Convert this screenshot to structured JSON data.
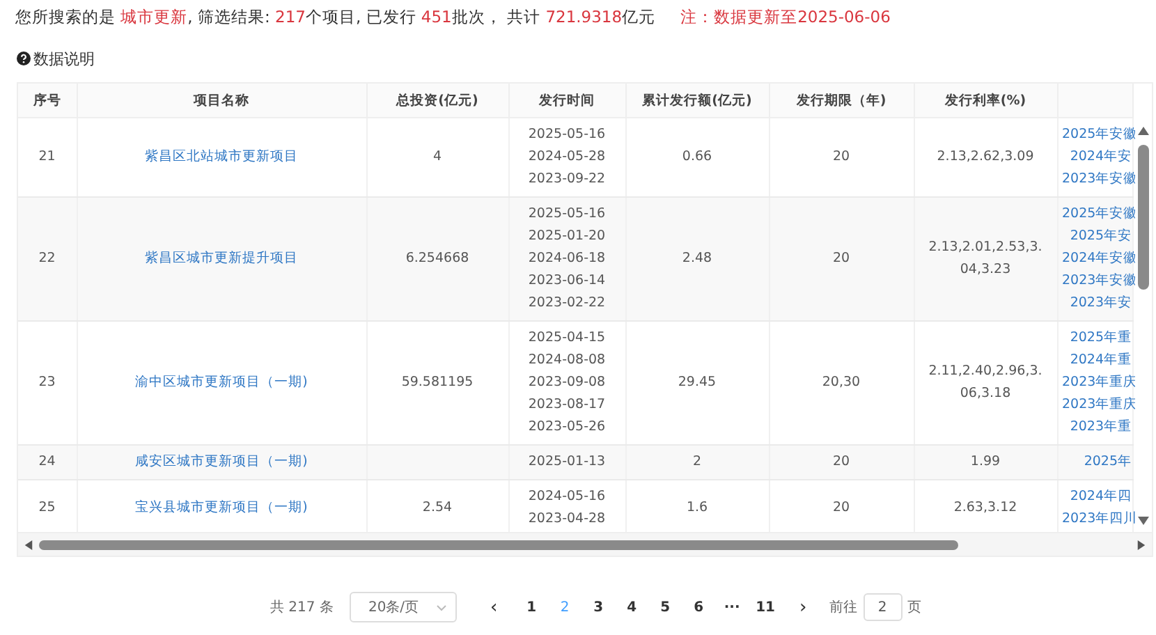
{
  "summary": {
    "segments": [
      {
        "text": "您所搜索的是 ",
        "highlight": false
      },
      {
        "text": "城市更新",
        "highlight": true
      },
      {
        "text": ", 筛选结果: ",
        "highlight": false
      },
      {
        "text": "217",
        "highlight": true
      },
      {
        "text": "个项目, 已发行 ",
        "highlight": false
      },
      {
        "text": "451",
        "highlight": true
      },
      {
        "text": "批次， 共计 ",
        "highlight": false
      },
      {
        "text": "721.9318",
        "highlight": true
      },
      {
        "text": "亿元",
        "highlight": false
      }
    ],
    "note": "注：数据更新至2025-06-06"
  },
  "help_link": {
    "label": "数据说明"
  },
  "table": {
    "columns": [
      "序号",
      "项目名称",
      "总投资(亿元)",
      "发行时间",
      "累计发行额(亿元)",
      "发行期限（年)",
      "发行利率(%)"
    ],
    "rows": [
      {
        "index": "21",
        "name": "紫昌区北站城市更新项目",
        "investment": "4",
        "dates": [
          "2025-05-16",
          "2024-05-28",
          "2023-09-22"
        ],
        "amount": "0.66",
        "term": "20",
        "rates": "2.13,2.62,3.09",
        "documents": [
          "2025年安徽",
          "2024年安",
          "2023年安徽"
        ]
      },
      {
        "index": "22",
        "name": "紫昌区城市更新提升项目",
        "investment": "6.254668",
        "dates": [
          "2025-05-16",
          "2025-01-20",
          "2024-06-18",
          "2023-06-14",
          "2023-02-22"
        ],
        "amount": "2.48",
        "term": "20",
        "rates": "2.13,2.01,2.53,3.04,3.23",
        "documents": [
          "2025年安徽",
          "2025年安",
          "2024年安徽",
          "2023年安徽",
          "2023年安"
        ]
      },
      {
        "index": "23",
        "name": "渝中区城市更新项目（一期)",
        "investment": "59.581195",
        "dates": [
          "2025-04-15",
          "2024-08-08",
          "2023-09-08",
          "2023-08-17",
          "2023-05-26"
        ],
        "amount": "29.45",
        "term": "20,30",
        "rates": "2.11,2.40,2.96,3.06,3.18",
        "documents": [
          "2025年重",
          "2024年重",
          "2023年重庆",
          "2023年重庆",
          "2023年重"
        ]
      },
      {
        "index": "24",
        "name": "咸安区城市更新项目（一期)",
        "investment": "",
        "dates": [
          "2025-01-13"
        ],
        "amount": "2",
        "term": "20",
        "rates": "1.99",
        "documents": [
          "2025年"
        ]
      },
      {
        "index": "25",
        "name": "宝兴县城市更新项目（一期)",
        "investment": "2.54",
        "dates": [
          "2024-05-16",
          "2023-04-28"
        ],
        "amount": "1.6",
        "term": "20",
        "rates": "2.63,3.12",
        "documents": [
          "2024年四",
          "2023年四川"
        ]
      }
    ]
  },
  "pagination": {
    "total": "共 217 条",
    "page_size": "20条/页",
    "prev": "‹",
    "pages": [
      {
        "label": "1",
        "selected": false
      },
      {
        "label": "2",
        "selected": true
      },
      {
        "label": "3",
        "selected": false
      },
      {
        "label": "4",
        "selected": false
      },
      {
        "label": "5",
        "selected": false
      },
      {
        "label": "6",
        "selected": false
      },
      {
        "label": "···",
        "selected": false
      },
      {
        "label": "11",
        "selected": false
      }
    ],
    "next": "›",
    "goto_label": "前往",
    "goto_value": "2",
    "goto_suffix": "页"
  }
}
